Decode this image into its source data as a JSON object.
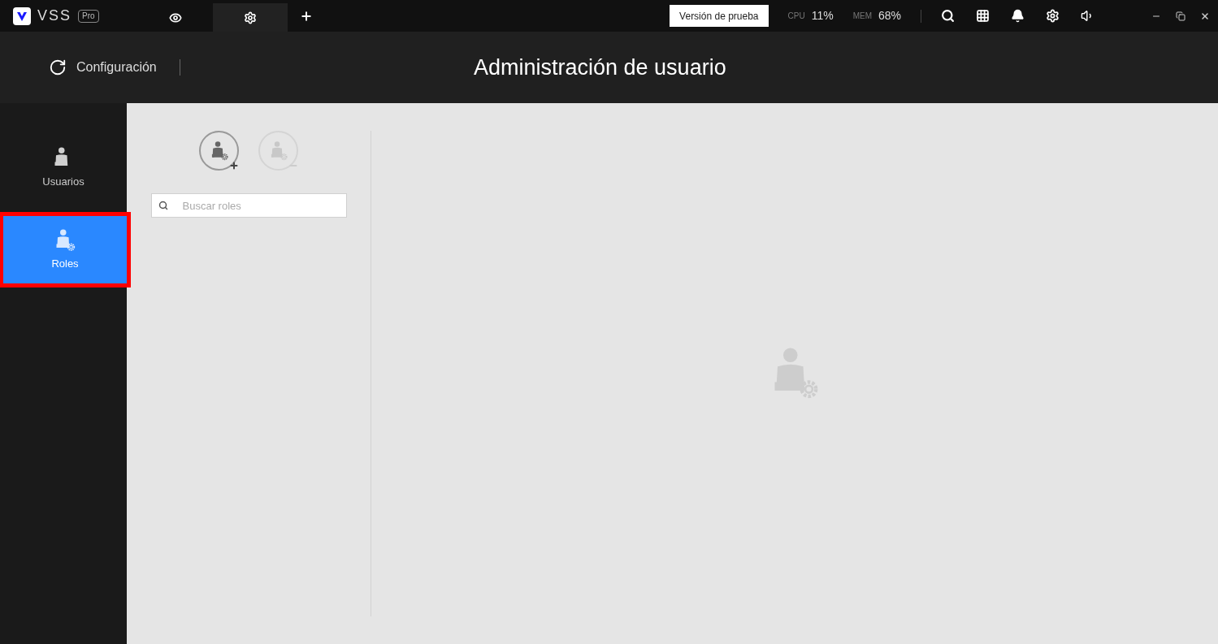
{
  "app": {
    "name": "VSS",
    "edition": "Pro"
  },
  "tabs": [
    {
      "kind": "eye",
      "selected": false
    },
    {
      "kind": "gear",
      "selected": true
    }
  ],
  "trial_button": "Versión de prueba",
  "stats": [
    {
      "label": "CPU",
      "value": "11%"
    },
    {
      "label": "MEM",
      "value": "68%"
    }
  ],
  "header": {
    "section": "Configuración",
    "title": "Administración de usuario"
  },
  "sidebar": {
    "items": [
      {
        "label": "Usuarios",
        "kind": "user",
        "selected": false,
        "highlighted": false
      },
      {
        "label": "Roles",
        "kind": "role",
        "selected": true,
        "highlighted": true
      }
    ]
  },
  "role_actions": [
    {
      "kind": "add",
      "disabled": false
    },
    {
      "kind": "remove",
      "disabled": true
    }
  ],
  "search": {
    "placeholder": "Buscar roles"
  }
}
